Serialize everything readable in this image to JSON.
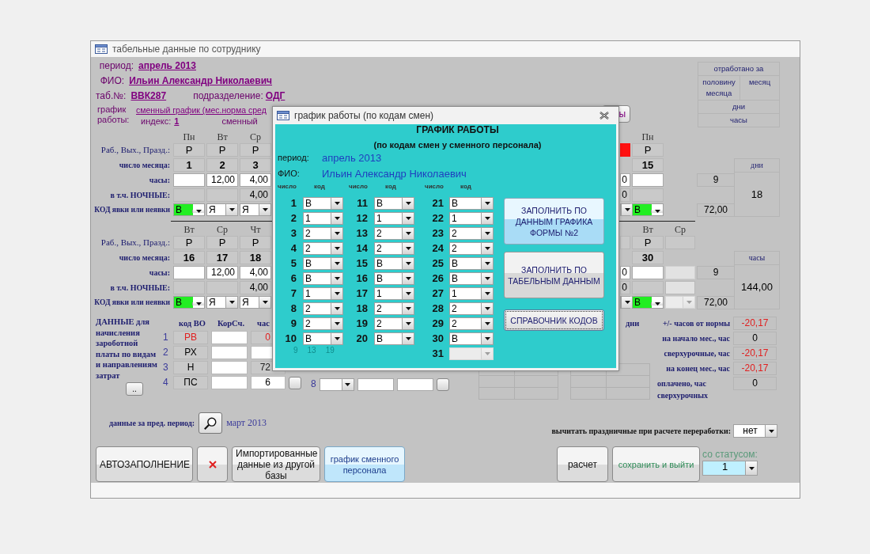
{
  "window": {
    "title": "табельные данные по сотруднику"
  },
  "header": {
    "period_label": "период:",
    "period": "апрель 2013",
    "fio_label": "ФИО:",
    "fio": "Ильин Александр Николаевич",
    "tab_label": "таб.№:",
    "tab": "ВВК287",
    "dept_label": "подразделение:",
    "dept": "ОДГ",
    "schedule_label": "график работы:",
    "schedule": "сменный график (мес.норма сред",
    "index_label": "индекс:",
    "index": "1",
    "shift": "сменный"
  },
  "back_button": {
    "label": "ы"
  },
  "worked": {
    "title": "отработано за",
    "half": "половину месяца",
    "month": "месяц",
    "days": "дни",
    "hours": "часы"
  },
  "weeks": [
    {
      "labels": [
        "Раб., Вых., Празд.:",
        "число месяца:",
        "часы:",
        "в т.ч. НОЧНЫЕ:",
        "КОД явки или неявки"
      ],
      "days": [
        {
          "weekday": "Пн",
          "type": "Р",
          "date": "1",
          "code": "В",
          "highlight": true,
          "disabled": false
        },
        {
          "weekday": "Вт",
          "type": "Р",
          "date": "2",
          "hours": "12,00",
          "code": "Я",
          "highlight": false,
          "disabled": false
        },
        {
          "weekday": "Ср",
          "type": "Р",
          "date": "3",
          "hours": "4,00",
          "night": "4,00",
          "code": "Я",
          "highlight": false,
          "disabled": false
        }
      ],
      "edge": {
        "holiday": true,
        "hours": "0",
        "night": "0"
      },
      "right_days": [
        {
          "weekday": "Пн",
          "type": "Р",
          "date": "15",
          "code": "В",
          "highlight": true,
          "disabled": false
        }
      ],
      "sum_days": "9",
      "sum_hours": "72,00",
      "total_label": "дни",
      "total": "18"
    },
    {
      "labels": [
        "Раб., Вых., Празд.:",
        "число месяца:",
        "часы:",
        "в т.ч. НОЧНЫЕ:",
        "КОД явки или неявки"
      ],
      "days": [
        {
          "weekday": "Вт",
          "type": "Р",
          "date": "16",
          "code": "В",
          "highlight": true,
          "disabled": false
        },
        {
          "weekday": "Ср",
          "type": "Р",
          "date": "17",
          "hours": "12,00",
          "code": "Я",
          "highlight": false,
          "disabled": false
        },
        {
          "weekday": "Чт",
          "type": "Р",
          "date": "18",
          "hours": "4,00",
          "night": "4,00",
          "code": "Я",
          "highlight": false,
          "disabled": false
        }
      ],
      "edge": {
        "holiday": false,
        "hours": "0",
        "night": "0"
      },
      "right_days": [
        {
          "weekday": "Вт",
          "type": "Р",
          "date": "30",
          "code": "В",
          "highlight": true,
          "disabled": false
        },
        {
          "weekday": "Ср",
          "highlight": false,
          "disabled": true
        }
      ],
      "sum_days": "9",
      "sum_hours": "72,00",
      "total_label": "часы",
      "total": "144,00"
    }
  ],
  "data": {
    "title": "ДАННЫЕ для начисления зароботной платы по видам и направлениям затрат",
    "more": "..",
    "columns": [
      "код ВО",
      "КорСч.",
      "час"
    ],
    "rows": [
      {
        "num": "1",
        "code": "РВ",
        "alert": true,
        "value": "0",
        "readonly": true
      },
      {
        "num": "2",
        "code": "РХ",
        "alert": false,
        "readonly": false
      },
      {
        "num": "3",
        "code": "Н",
        "alert": false,
        "value": "72",
        "readonly": true
      },
      {
        "num": "4",
        "code": "ПС",
        "alert": false,
        "value": "6",
        "readonly": false,
        "button": true
      }
    ],
    "extra_row": {
      "num": "8"
    }
  },
  "stats": {
    "days_label": "дни",
    "items": [
      {
        "label": "+/- часов от нормы",
        "value": "-20,17",
        "negative": true
      },
      {
        "label": "на начало мес., час",
        "value": "0",
        "negative": false
      },
      {
        "label": "сверхурочные, час",
        "value": "-20,17",
        "negative": true
      },
      {
        "label": "на конец мес., час",
        "value": "-20,17",
        "negative": true
      },
      {
        "label": "оплачено, час сверхурочных",
        "value": "0",
        "negative": false
      }
    ]
  },
  "prev": {
    "label": "данные за пред. период:",
    "value": "март 2013"
  },
  "holidays": {
    "label": "вычитать праздничные при расчете переработки:",
    "value": "нет"
  },
  "buttons_left": [
    {
      "label": "АВТОЗАПОЛНЕНИЕ",
      "kind": "plain"
    },
    {
      "kind": "delete"
    },
    {
      "label": "Импортированные данные из другой базы",
      "kind": "plain"
    },
    {
      "label": "график сменного персонала",
      "kind": "accent"
    }
  ],
  "buttons_right": [
    {
      "label": "расчет",
      "kind": "plain"
    },
    {
      "label": "сохранить и выйти",
      "kind": "save"
    }
  ],
  "status": {
    "label": "со статусом:",
    "value": "1"
  },
  "dialog": {
    "title": "график работы (по кодам смен)",
    "heading": "ГРАФИК РАБОТЫ",
    "subheading": "(по кодам смен у сменного персонала)",
    "period_label": "период:",
    "period": "апрель 2013",
    "fio_label": "ФИО:",
    "fio": "Ильин Александр Николаевич",
    "columns": [
      {
        "headers": [
          "число",
          "код"
        ],
        "days": [
          {
            "day": "1",
            "code": "В",
            "disabled": false
          },
          {
            "day": "2",
            "code": "1",
            "disabled": false
          },
          {
            "day": "3",
            "code": "2",
            "disabled": false
          },
          {
            "day": "4",
            "code": "2",
            "disabled": false
          },
          {
            "day": "5",
            "code": "В",
            "disabled": false
          },
          {
            "day": "6",
            "code": "В",
            "disabled": false
          },
          {
            "day": "7",
            "code": "1",
            "disabled": false
          },
          {
            "day": "8",
            "code": "2",
            "disabled": false
          },
          {
            "day": "9",
            "code": "2",
            "disabled": false
          },
          {
            "day": "10",
            "code": "В",
            "disabled": false
          }
        ]
      },
      {
        "headers": [
          "число",
          "код"
        ],
        "days": [
          {
            "day": "11",
            "code": "В",
            "disabled": false
          },
          {
            "day": "12",
            "code": "1",
            "disabled": false
          },
          {
            "day": "13",
            "code": "2",
            "disabled": false
          },
          {
            "day": "14",
            "code": "2",
            "disabled": false
          },
          {
            "day": "15",
            "code": "В",
            "disabled": false
          },
          {
            "day": "16",
            "code": "В",
            "disabled": false
          },
          {
            "day": "17",
            "code": "1",
            "disabled": false
          },
          {
            "day": "18",
            "code": "2",
            "disabled": false
          },
          {
            "day": "19",
            "code": "2",
            "disabled": false
          },
          {
            "day": "20",
            "code": "В",
            "disabled": false
          }
        ]
      },
      {
        "headers": [
          "число",
          "код"
        ],
        "days": [
          {
            "day": "21",
            "code": "В",
            "disabled": false
          },
          {
            "day": "22",
            "code": "1",
            "disabled": false
          },
          {
            "day": "23",
            "code": "2",
            "disabled": false
          },
          {
            "day": "24",
            "code": "2",
            "disabled": false
          },
          {
            "day": "25",
            "code": "В",
            "disabled": false
          },
          {
            "day": "26",
            "code": "В",
            "disabled": false
          },
          {
            "day": "27",
            "code": "1",
            "disabled": false
          },
          {
            "day": "28",
            "code": "2",
            "disabled": false
          },
          {
            "day": "29",
            "code": "2",
            "disabled": false
          },
          {
            "day": "30",
            "code": "В",
            "disabled": false
          },
          {
            "day": "31",
            "disabled": true
          }
        ]
      }
    ],
    "ghost": [
      "9",
      "13",
      "19"
    ],
    "buttons": [
      {
        "label": "ЗАПОЛНИТЬ ПО ДАННЫМ ГРАФИКА ФОРМЫ №2",
        "kind": "accent"
      },
      {
        "label": "ЗАПОЛНИТЬ ПО ТАБЕЛЬНЫМ ДАННЫМ",
        "kind": "plain"
      },
      {
        "label": "СПРАВОЧНИК КОДОВ",
        "kind": "focused"
      }
    ]
  }
}
